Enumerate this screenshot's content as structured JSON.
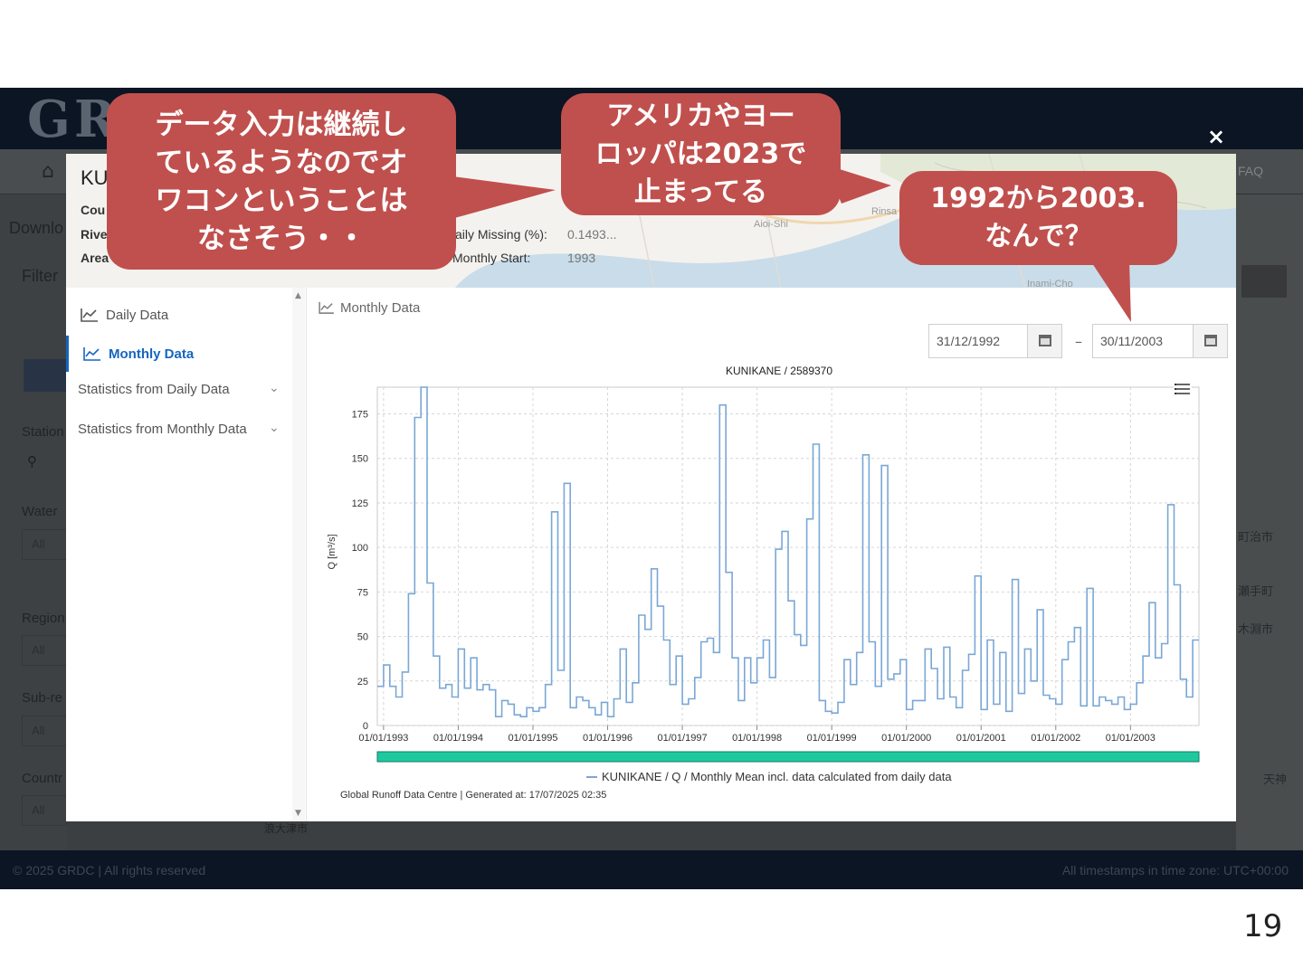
{
  "app": {
    "logo": "GR",
    "faq": "FAQ",
    "sidebar": {
      "download": "Downlo",
      "filter": "Filter",
      "station": "Station",
      "water": "Water",
      "region": "Region",
      "subregion": "Sub-re",
      "country": "Countr",
      "select_all": "All"
    },
    "map_labels": [
      "町治市",
      "瀬手町",
      "木淵市",
      "天神",
      "浪大津市"
    ],
    "footer": {
      "copyright": "© 2025 GRDC | All rights reserved",
      "timezone": "All timestamps in time zone: UTC+00:00"
    }
  },
  "modal": {
    "station_title": "KU",
    "labels": {
      "country": "Cou",
      "river": "Rive",
      "area": "Area",
      "daily_missing": "aily Missing (%):",
      "monthly_start": "Monthly Start:"
    },
    "values": {
      "daily_missing": "0.1493...",
      "monthly_start": "1993"
    },
    "map_text": [
      "Aioi-Shi",
      "Inami-Cho",
      "Rinsa"
    ],
    "nav": {
      "daily": "Daily Data",
      "monthly": "Monthly Data",
      "stats_daily": "Statistics from Daily Data",
      "stats_monthly": "Statistics from Monthly Data"
    },
    "content_title": "Monthly Data",
    "date_from": "31/12/1992",
    "date_to": "30/11/2003",
    "date_sep": "–",
    "close": "×"
  },
  "chart_data": {
    "type": "line",
    "step": true,
    "title": "KUNIKANE / 2589370",
    "ylabel": "Q [m³/s]",
    "xlabel": "",
    "ylim": [
      0,
      190
    ],
    "yticks": [
      0,
      25,
      50,
      75,
      100,
      125,
      150,
      175
    ],
    "grid": true,
    "x_start": "12/1992",
    "x_end": "11/2003",
    "xtick_labels": [
      "01/01/1993",
      "01/01/1994",
      "01/01/1995",
      "01/01/1996",
      "01/01/1997",
      "01/01/1998",
      "01/01/1999",
      "01/01/2000",
      "01/01/2001",
      "01/01/2002",
      "01/01/2003"
    ],
    "legend": "KUNIKANE / Q / Monthly Mean incl. data calculated from daily data",
    "credit": "Global Runoff Data Centre | Generated at: 17/07/2025 02:35",
    "series": [
      {
        "name": "KUNIKANE / Q / Monthly Mean incl. data calculated from daily data",
        "color": "#7aa7d6",
        "values": [
          22,
          34,
          22,
          16,
          30,
          74,
          173,
          190,
          80,
          39,
          21,
          23,
          16,
          43,
          21,
          38,
          20,
          23,
          20,
          5,
          14,
          12,
          6,
          5,
          10,
          8,
          10,
          23,
          120,
          31,
          136,
          10,
          16,
          14,
          10,
          6,
          13,
          5,
          15,
          43,
          13,
          24,
          62,
          54,
          88,
          67,
          48,
          23,
          39,
          12,
          15,
          27,
          47,
          49,
          41,
          180,
          86,
          38,
          14,
          38,
          24,
          38,
          48,
          27,
          99,
          109,
          70,
          51,
          45,
          116,
          158,
          14,
          8,
          7,
          13,
          37,
          23,
          41,
          152,
          47,
          22,
          146,
          26,
          29,
          37,
          9,
          14,
          14,
          43,
          32,
          15,
          44,
          16,
          10,
          31,
          40,
          84,
          9,
          48,
          12,
          41,
          8,
          82,
          18,
          43,
          25,
          65,
          17,
          15,
          12,
          37,
          47,
          55,
          11,
          77,
          11,
          16,
          14,
          12,
          16,
          9,
          12,
          24,
          39,
          69,
          38,
          46,
          124,
          79,
          26,
          16,
          48
        ]
      }
    ]
  },
  "callouts": [
    {
      "text": "データ入力は継続し\nているようなのでオ\nワコンということは\nなさそう・・"
    },
    {
      "text": "アメリカやヨー\nロッパは2023で\n止まってる"
    },
    {
      "text": "1992から2003.\nなんで？"
    }
  ],
  "page_number": "19"
}
